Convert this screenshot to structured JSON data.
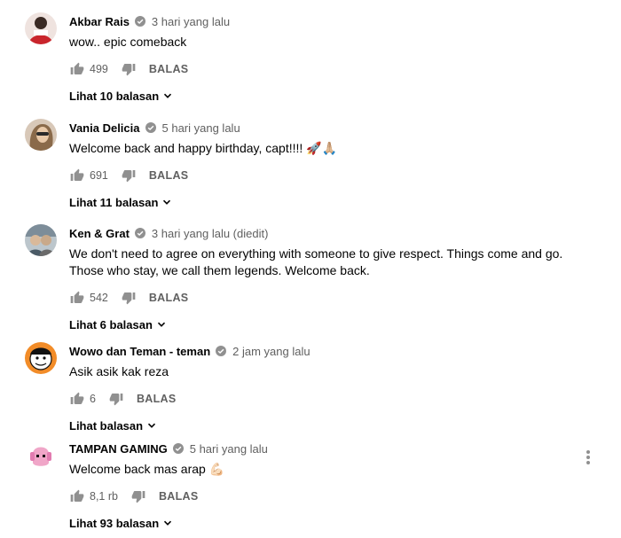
{
  "comments": [
    {
      "author": "Akbar Rais",
      "time": "3 hari yang lalu",
      "text": "wow.. epic comeback",
      "likes": "499",
      "reply_label": "BALAS",
      "replies_label": "Lihat 10 balasan",
      "avatar_color": "#c9252c"
    },
    {
      "author": "Vania Delicia",
      "time": "5 hari yang lalu",
      "text": "Welcome back and happy birthday, capt!!!! 🚀🙏🏼",
      "likes": "691",
      "reply_label": "BALAS",
      "replies_label": "Lihat 11 balasan",
      "avatar_color": "#b9a08a"
    },
    {
      "author": "Ken & Grat",
      "time": "3 hari yang lalu (diedit)",
      "text": "We don't need to agree on everything with someone to give respect. Things come and go. Those who stay, we call them legends. Welcome back.",
      "likes": "542",
      "reply_label": "BALAS",
      "replies_label": "Lihat 6 balasan",
      "avatar_color": "#8a9aa6"
    },
    {
      "author": "Wowo dan Teman - teman",
      "time": "2 jam yang lalu",
      "text": "Asik asik kak reza",
      "likes": "6",
      "reply_label": "BALAS",
      "replies_label": "Lihat balasan",
      "avatar_color": "#f28c28"
    },
    {
      "author": "TAMPAN GAMING",
      "time": "5 hari yang lalu",
      "text": "Welcome back mas arap 💪🏻",
      "likes": "8,1 rb",
      "reply_label": "BALAS",
      "replies_label": "Lihat 93 balasan",
      "avatar_color": "#f0a6c8"
    }
  ],
  "icons": {
    "verified": "verified-check-icon",
    "like": "thumbs-up-icon",
    "dislike": "thumbs-down-icon",
    "expand": "chevron-down-icon",
    "menu": "more-vertical-icon"
  },
  "colors": {
    "text": "#030303",
    "secondary": "#606060",
    "icon": "#909090"
  }
}
